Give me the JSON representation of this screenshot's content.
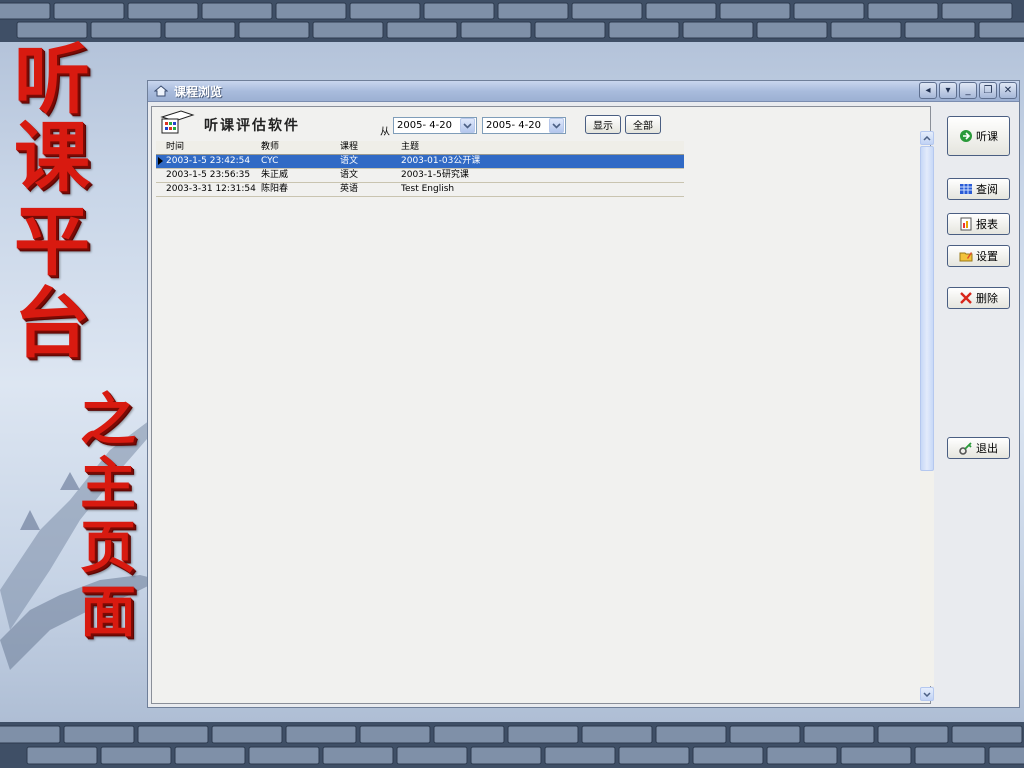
{
  "page_title": {
    "chars_main": [
      "听",
      "课",
      "平",
      "台"
    ],
    "chars_sub": [
      "之",
      "主",
      "页",
      "面"
    ]
  },
  "window": {
    "title": "课程浏览",
    "app_title": "听课评估软件",
    "controls": [
      "◂",
      "▾",
      "_",
      "❐",
      "✕"
    ]
  },
  "filter": {
    "from_label": "从",
    "date_from": "2005- 4-20",
    "date_to": "2005- 4-20",
    "show_button": "显示",
    "all_button": "全部"
  },
  "table": {
    "columns": [
      "时间",
      "教师",
      "课程",
      "主题"
    ],
    "rows": [
      {
        "time": "2003-1-5 23:42:54",
        "teacher": "CYC",
        "course": "语文",
        "topic": "2003-01-03公开课"
      },
      {
        "time": "2003-1-5 23:56:35",
        "teacher": "朱正威",
        "course": "语文",
        "topic": "2003-1-5研究课"
      },
      {
        "time": "2003-3-31 12:31:54",
        "teacher": "陈阳春",
        "course": "英语",
        "topic": "Test English"
      }
    ]
  },
  "sidebar": {
    "listen": "听课",
    "view": "查阅",
    "report": "报表",
    "settings": "设置",
    "delete": "删除",
    "exit": "退出"
  },
  "colors": {
    "title_red": "#d81a10",
    "selection_blue": "#316ac5"
  }
}
